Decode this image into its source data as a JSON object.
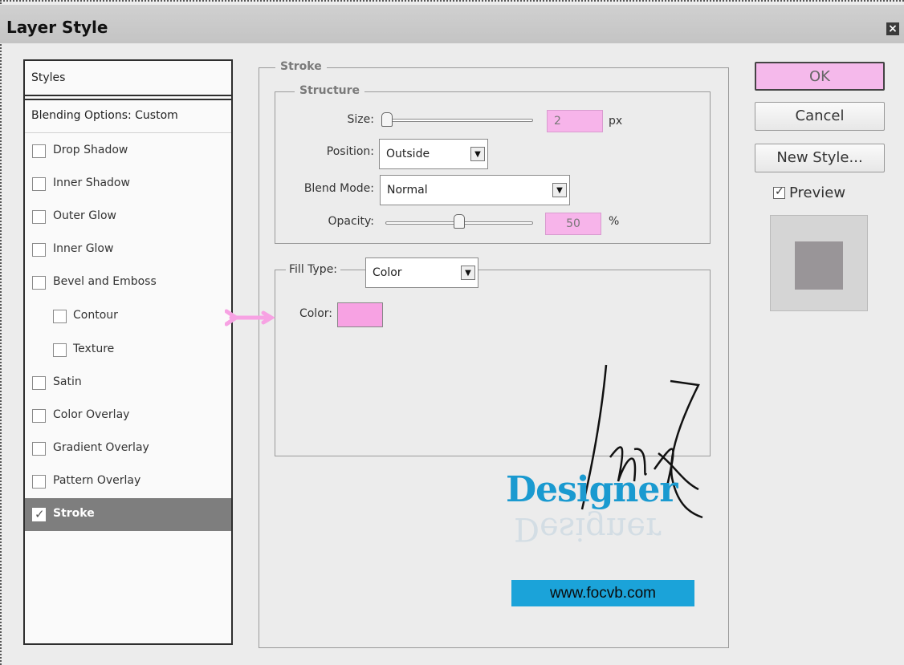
{
  "window": {
    "title": "Layer Style",
    "close_glyph": "×"
  },
  "styles_list": {
    "header": "Styles",
    "blending_options": "Blending Options: Custom",
    "items": [
      {
        "label": "Drop Shadow",
        "checked": false,
        "indent": false
      },
      {
        "label": "Inner Shadow",
        "checked": false,
        "indent": false
      },
      {
        "label": "Outer Glow",
        "checked": false,
        "indent": false
      },
      {
        "label": "Inner Glow",
        "checked": false,
        "indent": false
      },
      {
        "label": "Bevel and Emboss",
        "checked": false,
        "indent": false
      },
      {
        "label": "Contour",
        "checked": false,
        "indent": true
      },
      {
        "label": "Texture",
        "checked": false,
        "indent": true
      },
      {
        "label": "Satin",
        "checked": false,
        "indent": false
      },
      {
        "label": "Color Overlay",
        "checked": false,
        "indent": false
      },
      {
        "label": "Gradient Overlay",
        "checked": false,
        "indent": false
      },
      {
        "label": "Pattern Overlay",
        "checked": false,
        "indent": false
      },
      {
        "label": "Stroke",
        "checked": true,
        "indent": false,
        "selected": true
      }
    ]
  },
  "stroke": {
    "legend": "Stroke",
    "structure": {
      "legend": "Structure",
      "size_label": "Size:",
      "size_value": "2",
      "size_unit": "px",
      "position_label": "Position:",
      "position_value": "Outside",
      "blend_mode_label": "Blend Mode:",
      "blend_mode_value": "Normal",
      "opacity_label": "Opacity:",
      "opacity_value": "50",
      "opacity_unit": "%",
      "opacity_fraction": 0.5
    },
    "fill": {
      "fill_type_label": "Fill Type:",
      "fill_type_value": "Color",
      "color_label": "Color:",
      "color_value": "#f7a2e3"
    }
  },
  "buttons": {
    "ok": "OK",
    "cancel": "Cancel",
    "new_style": "New Style..."
  },
  "preview": {
    "label": "Preview",
    "checked": true
  },
  "watermark": {
    "designer": "Designer",
    "url": "www.focvb.com"
  },
  "colors": {
    "accent_pink": "#f7b4ea",
    "selected_row": "#7e7e7e",
    "watermark_blue": "#1a9ad0"
  }
}
